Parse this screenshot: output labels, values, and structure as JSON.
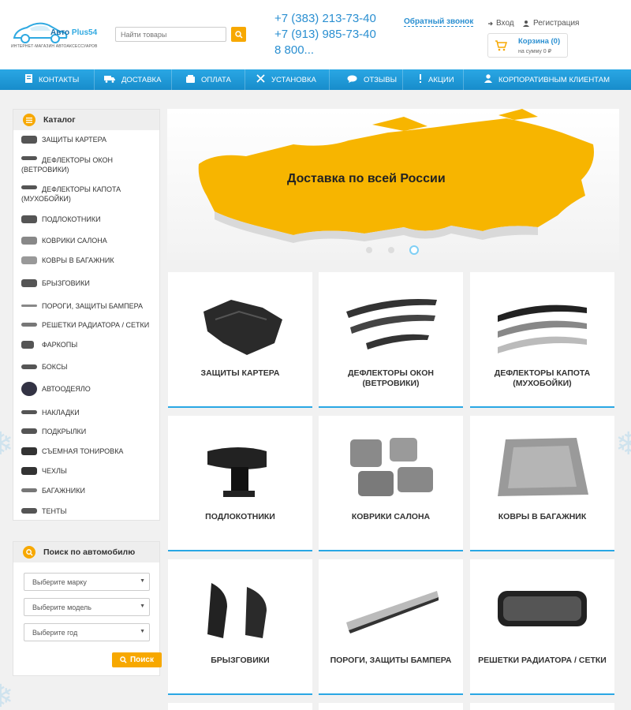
{
  "header": {
    "logo_main": "Авто",
    "logo_accent": "Plus54",
    "logo_tagline": "ИНТЕРНЕТ-МАГАЗИН АВТОАКСЕССУАРОВ",
    "search_placeholder": "Найти товары",
    "phones": [
      "+7 (383) 213-73-40",
      "+7 (913) 985-73-40",
      "8 800..."
    ],
    "callback": "Обратный звонок",
    "login": "Вход",
    "register": "Регистрация",
    "cart_title": "Корзина (0)",
    "cart_sum": "на сумму 0 ₽"
  },
  "nav": [
    {
      "label": "КОНТАКТЫ",
      "icon": "contacts-icon"
    },
    {
      "label": "ДОСТАВКА",
      "icon": "truck-icon"
    },
    {
      "label": "ОПЛАТА",
      "icon": "wallet-icon"
    },
    {
      "label": "УСТАНОВКА",
      "icon": "tools-icon"
    },
    {
      "label": "ОТЗЫВЫ",
      "icon": "chat-icon"
    },
    {
      "label": "АКЦИИ",
      "icon": "exclamation-icon"
    },
    {
      "label": "КОРПОРАТИВНЫМ КЛИЕНТАМ",
      "icon": "user-icon"
    }
  ],
  "catalog": {
    "title": "Каталог",
    "items": [
      "ЗАЩИТЫ КАРТЕРА",
      "ДЕФЛЕКТОРЫ ОКОН (ВЕТРОВИКИ)",
      "ДЕФЛЕКТОРЫ КАПОТА (МУХОБОЙКИ)",
      "ПОДЛОКОТНИКИ",
      "КОВРИКИ САЛОНА",
      "КОВРЫ В БАГАЖНИК",
      "БРЫЗГОВИКИ",
      "ПОРОГИ, ЗАЩИТЫ БАМПЕРА",
      "РЕШЕТКИ РАДИАТОРА / СЕТКИ",
      "ФАРКОПЫ",
      "БОКСЫ",
      "АВТООДЕЯЛО",
      "НАКЛАДКИ",
      "ПОДКРЫЛКИ",
      "СЪЕМНАЯ ТОНИРОВКА",
      "ЧЕХЛЫ",
      "БАГАЖНИКИ",
      "ТЕНТЫ"
    ]
  },
  "car_search": {
    "title": "Поиск по автомобилю",
    "make": "Выберите марку",
    "model": "Выберите модель",
    "year": "Выберите год",
    "button": "Поиск"
  },
  "banner": {
    "text": "Доставка по всей России",
    "slides": 3,
    "active_slide": 3,
    "map_color": "#f7b500"
  },
  "products": [
    "ЗАЩИТЫ КАРТЕРА",
    "ДЕФЛЕКТОРЫ ОКОН (ВЕТРОВИКИ)",
    "ДЕФЛЕКТОРЫ КАПОТА (МУХОБОЙКИ)",
    "ПОДЛОКОТНИКИ",
    "КОВРИКИ САЛОНА",
    "КОВРЫ В БАГАЖНИК",
    "БРЫЗГОВИКИ",
    "ПОРОГИ, ЗАЩИТЫ БАМПЕРА",
    "РЕШЕТКИ РАДИАТОРА / СЕТКИ"
  ],
  "colors": {
    "accent": "#2aa7e4",
    "button": "#f7a800"
  }
}
